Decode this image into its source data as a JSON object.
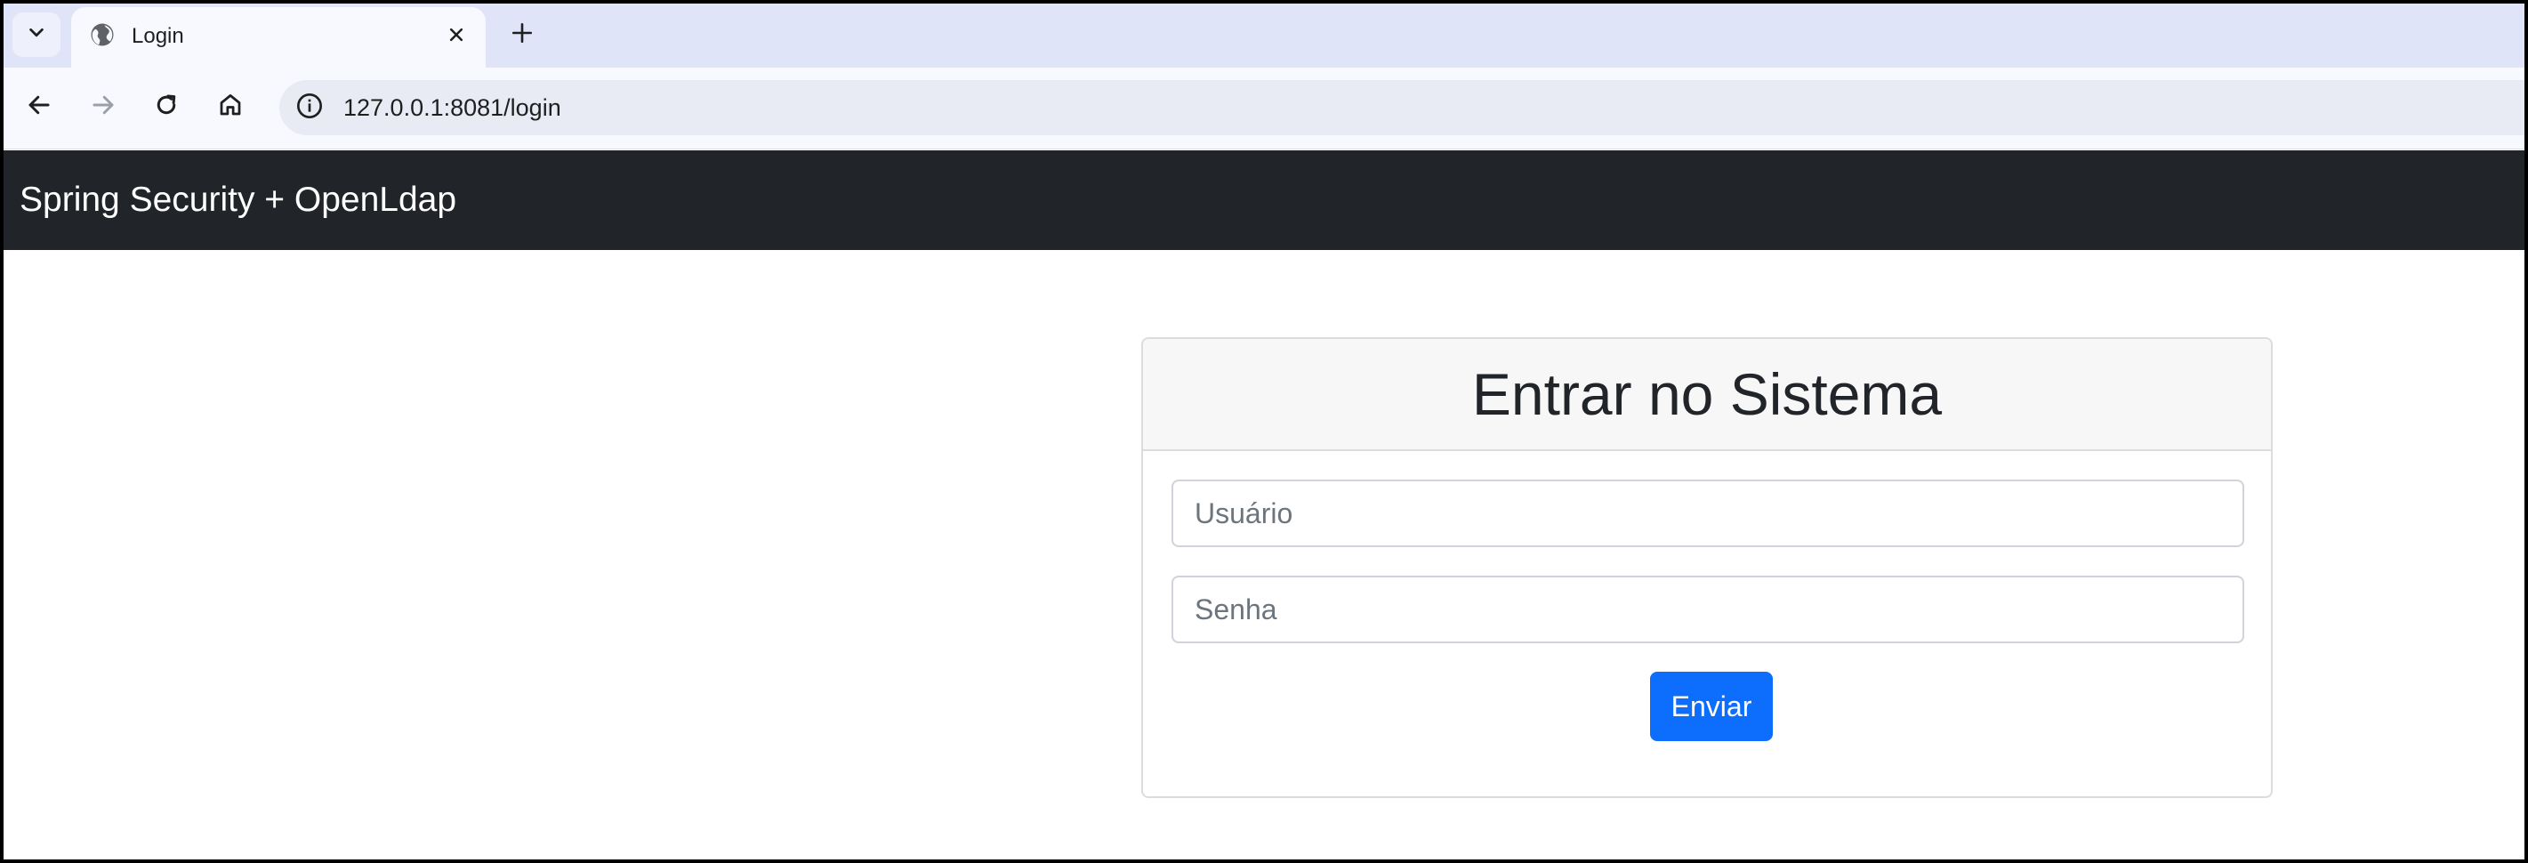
{
  "browser": {
    "tab": {
      "title": "Login",
      "favicon": "globe-icon",
      "close_icon": "close-icon"
    },
    "new_tab_icon": "plus-icon",
    "tab_menu_icon": "chevron-down-icon",
    "nav": {
      "back_icon": "arrow-left-icon",
      "forward_icon": "arrow-right-icon",
      "reload_icon": "reload-icon",
      "home_icon": "home-icon"
    },
    "address_bar": {
      "url": "127.0.0.1:8081/login",
      "site_info_icon": "info-icon"
    }
  },
  "page": {
    "navbar": {
      "brand": "Spring Security + OpenLdap",
      "background": "#212529"
    },
    "login_card": {
      "title": "Entrar no Sistema",
      "username": {
        "value": "",
        "placeholder": "Usuário"
      },
      "password": {
        "value": "",
        "placeholder": "Senha"
      },
      "submit_label": "Enviar",
      "submit_color": "#0d6efd"
    }
  }
}
